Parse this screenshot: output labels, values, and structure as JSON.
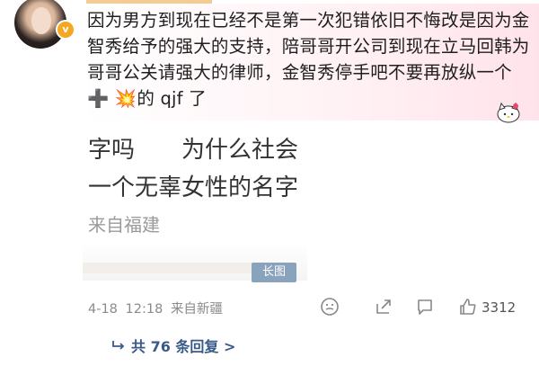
{
  "comment": {
    "text_part1": "因为男方到现在已经不是第一次犯错依旧不悔改是因为金智秀给予的强大的支持，陪哥哥开公司到现在立马回韩为哥哥公关请强大的律师，金智秀停手吧不要再放纵一个",
    "emoji_plus": "➕",
    "emoji_boom": "💥",
    "text_part2": "的 qjf 了"
  },
  "avatar": {
    "badge": "v"
  },
  "quoted_image": {
    "line1": "字吗　　为什么社会",
    "line2": "一个无辜女性的名字",
    "line3": "来自福建",
    "badge_label": "长图"
  },
  "meta": {
    "date": "4-18",
    "time": "12:18",
    "source": "来自新疆"
  },
  "actions": {
    "like_count": "3312",
    "icons": [
      "smiley-icon",
      "share-icon",
      "comment-icon",
      "like-icon"
    ]
  },
  "replies": {
    "label": "共 76 条回复 >"
  },
  "colors": {
    "bubble_pink": "#ffe3ea",
    "reply_link": "#3a5a88",
    "badge_orange": "#f5a623",
    "long_img_badge": "#8aa3bd"
  }
}
